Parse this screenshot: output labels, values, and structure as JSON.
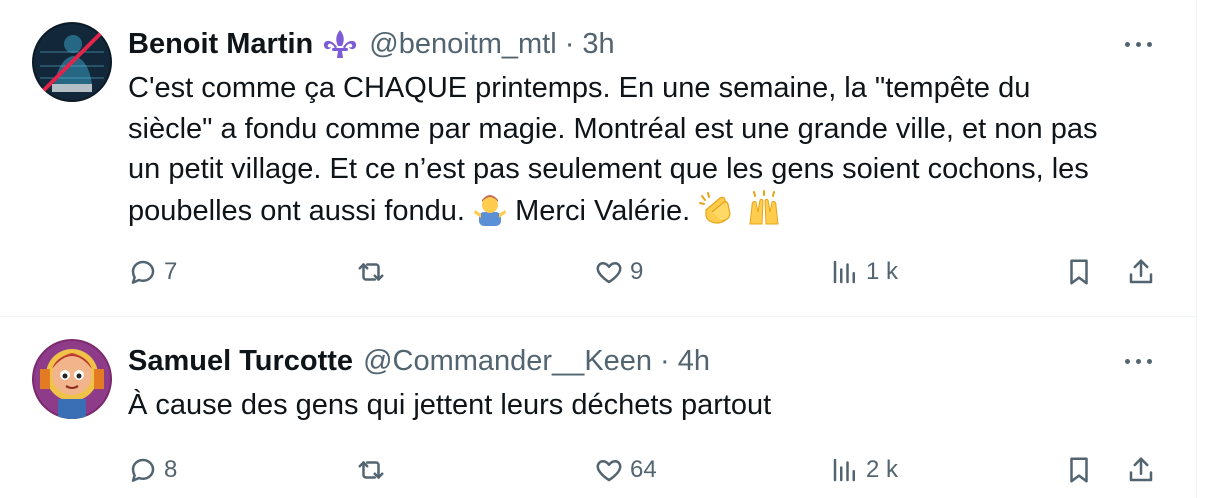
{
  "tweets": [
    {
      "name": "Benoit Martin",
      "handle": "@benoitm_mtl",
      "separator": "·",
      "time": "3h",
      "lines": [
        "C'est comme ça CHAQUE printemps. En une semaine, la \"tempête du",
        "siècle\" a fondu comme par magie. Montréal est une grande ville, et non pas",
        "un petit village. Et ce n’est pas seulement que les gens soient cochons, les",
        "poubelles ont aussi fondu."
      ],
      "line4_suffix": "Merci Valérie.",
      "emojis": [
        "man-shrugging-emoji",
        "clapping-hands-emoji",
        "raising-hands-emoji"
      ],
      "badge": "fleur-de-lis-icon",
      "replies": "7",
      "retweets": "",
      "likes": "9",
      "views": "1 k"
    },
    {
      "name": "Samuel Turcotte",
      "handle": "@Commander__Keen",
      "separator": "·",
      "time": "4h",
      "lines": [
        "À cause des gens qui jettent leurs déchets partout"
      ],
      "replies": "8",
      "retweets": "",
      "likes": "64",
      "views": "2 k"
    }
  ],
  "colors": {
    "text": "#0f1419",
    "secondary": "#536471",
    "divider": "#eff3f4",
    "badge": "#7b5bd6"
  }
}
